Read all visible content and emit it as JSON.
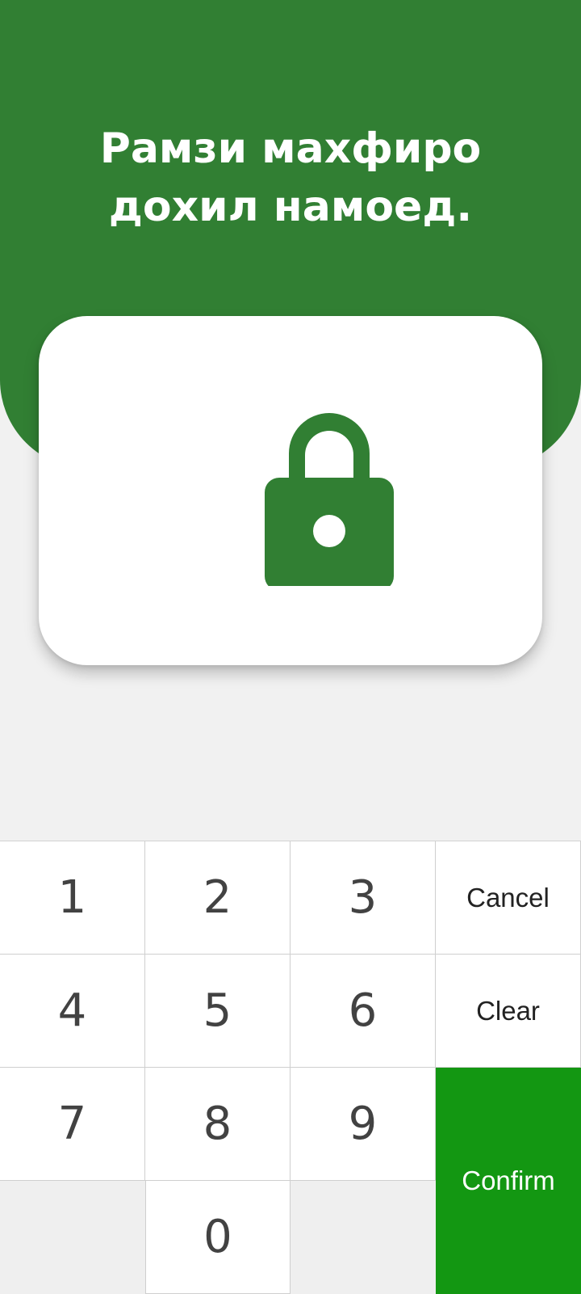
{
  "header": {
    "title_line_1": "Рамзи махфиро",
    "title_line_2": "дохил намоед.",
    "background_color": "#317f33"
  },
  "card": {
    "icon": "lock-icon",
    "icon_color": "#317f33"
  },
  "keypad": {
    "digits": [
      "1",
      "2",
      "3",
      "4",
      "5",
      "6",
      "7",
      "8",
      "9",
      "0"
    ],
    "cancel_label": "Cancel",
    "clear_label": "Clear",
    "confirm_label": "Confirm",
    "confirm_color": "#139712"
  }
}
